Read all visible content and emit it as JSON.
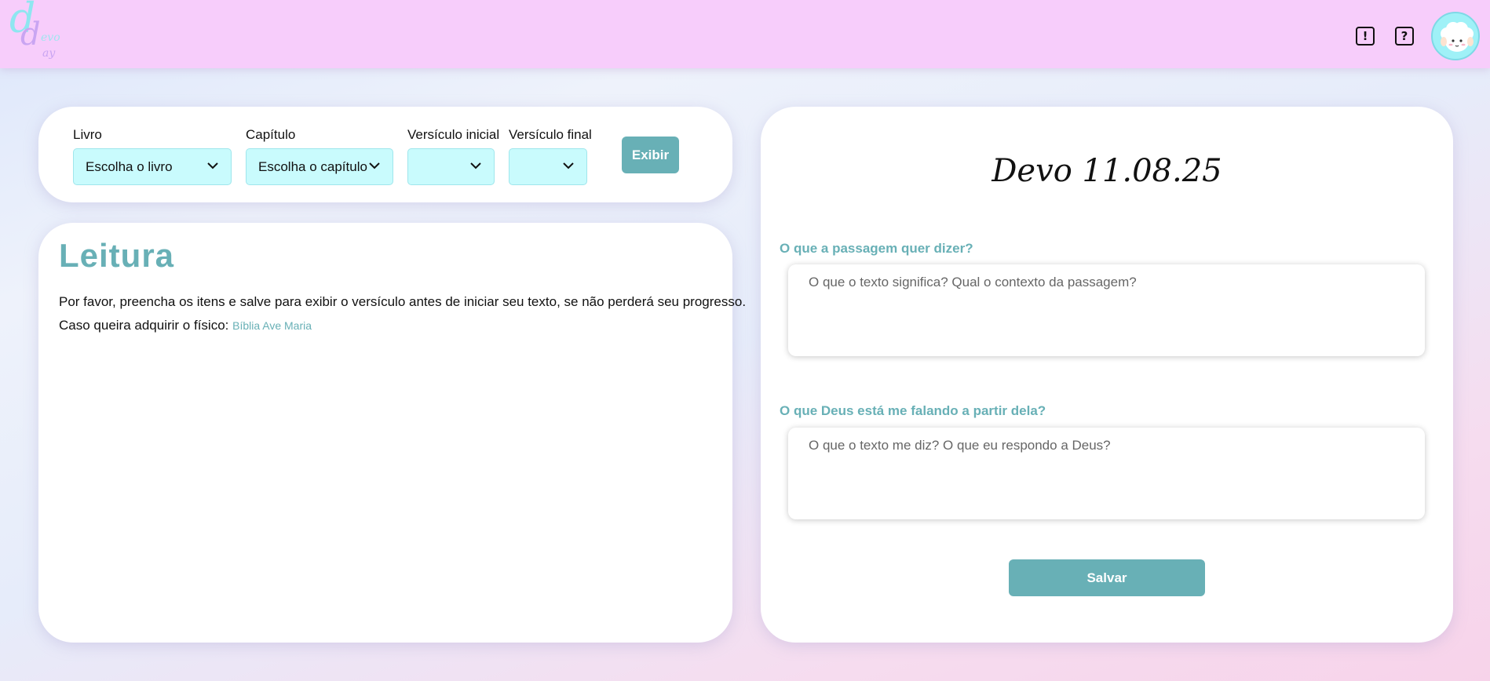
{
  "header": {
    "logo": {
      "letter_1": "d",
      "letter_2": "d",
      "word_1": "evo",
      "word_2": "ay"
    },
    "alert_icon": "!",
    "help_icon": "?",
    "avatar_icon": "sheep-avatar-icon"
  },
  "controls": {
    "book": {
      "label": "Livro",
      "value": "Escolha o livro"
    },
    "chapter": {
      "label": "Capítulo",
      "value": "Escolha o capítulo"
    },
    "verse_start": {
      "label": "Versículo inicial",
      "value": ""
    },
    "verse_end": {
      "label": "Versículo final",
      "value": ""
    },
    "show_button": "Exibir"
  },
  "reading": {
    "title": "Leitura",
    "instruction": "Por favor, preencha os itens e salve para exibir o versículo antes de iniciar seu texto, se não perderá seu progresso.",
    "purchase_text": "Caso queira adquirir o físico:",
    "purchase_link": "Bíblia Ave Maria"
  },
  "devo": {
    "title": "Devo 11.08.25",
    "question_1": "O que a passagem quer dizer?",
    "answer_1_placeholder": "O que o texto significa? Qual o contexto da passagem?",
    "question_2": "O que Deus está me falando a partir dela?",
    "answer_2_placeholder": "O que o texto me diz? O que eu respondo a Deus?",
    "save_button": "Salvar"
  },
  "colors": {
    "header_bg": "#f7cdfb",
    "accent": "#68b0b6",
    "select_bg": "#c9fbfd",
    "avatar_bg": "#9ff1f7"
  }
}
